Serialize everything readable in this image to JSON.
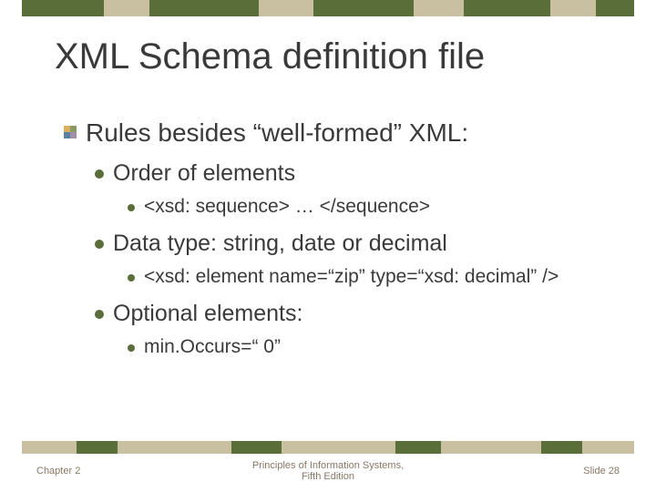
{
  "title": "XML Schema definition file",
  "lvl1_text": "Rules besides “well-formed” XML:",
  "items": [
    {
      "label": "Order of elements",
      "sub": "<xsd: sequence> … </sequence>"
    },
    {
      "label": "Data type: string, date or decimal",
      "sub": "<xsd: element name=“zip” type=“xsd: decimal” />"
    },
    {
      "label": "Optional elements:",
      "sub": "min.Occurs=“ 0”"
    }
  ],
  "footer": {
    "left": "Chapter 2",
    "center": "Principles of Information Systems,\nFifth Edition",
    "right": "Slide 28"
  }
}
